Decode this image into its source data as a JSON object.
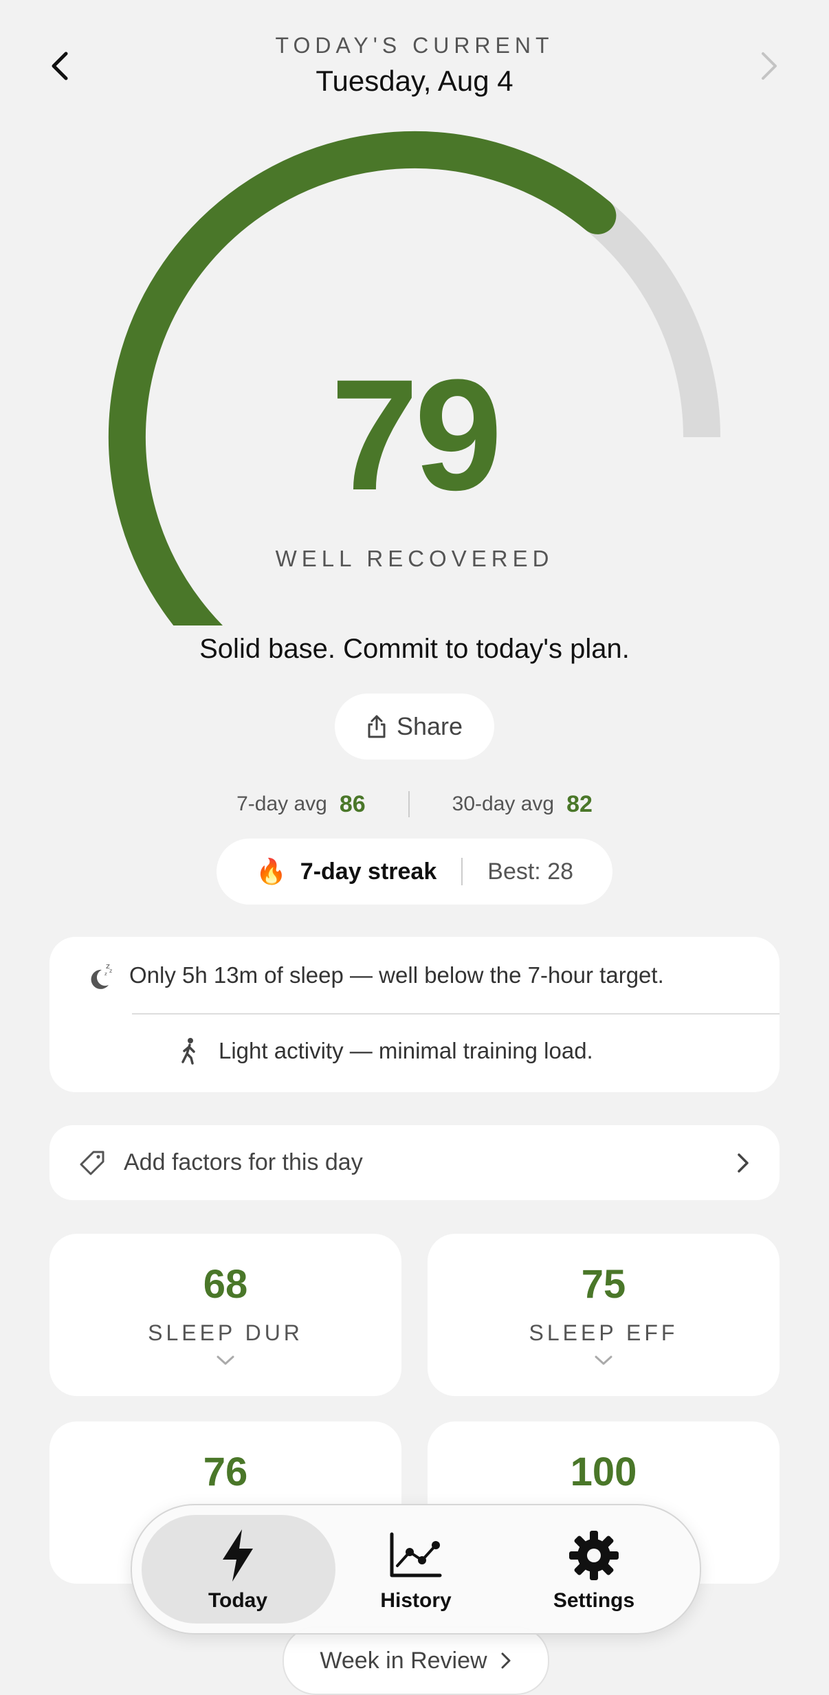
{
  "header": {
    "eyebrow": "TODAY'S CURRENT",
    "date": "Tuesday, Aug 4",
    "back_icon": "chevron-left-icon",
    "forward_icon": "chevron-right-icon"
  },
  "score": {
    "value": "79",
    "max": 100,
    "status": "WELL RECOVERED",
    "tagline": "Solid base. Commit to today's plan.",
    "accent_color": "#4a7729",
    "track_color": "#dadada"
  },
  "share": {
    "label": "Share",
    "icon": "share-icon"
  },
  "averages": {
    "seven_day_label": "7-day avg",
    "seven_day_value": "86",
    "thirty_day_label": "30-day avg",
    "thirty_day_value": "82"
  },
  "streak": {
    "emoji": "🔥",
    "label": "7-day streak",
    "best": "Best: 28"
  },
  "insights": [
    {
      "icon": "sleep-moon-icon",
      "text": "Only 5h 13m of sleep — well below the 7-hour target."
    },
    {
      "icon": "walking-icon",
      "text": "Light activity — minimal training load."
    }
  ],
  "factors": {
    "label": "Add factors for this day",
    "icon": "tag-icon"
  },
  "metrics": [
    {
      "value": "68",
      "label": "SLEEP DUR"
    },
    {
      "value": "75",
      "label": "SLEEP EFF"
    },
    {
      "value": "76",
      "label": ""
    },
    {
      "value": "100",
      "label": ""
    }
  ],
  "tabs": [
    {
      "label": "Today",
      "icon": "bolt-icon",
      "selected": true
    },
    {
      "label": "History",
      "icon": "chart-line-icon",
      "selected": false
    },
    {
      "label": "Settings",
      "icon": "gear-icon",
      "selected": false
    }
  ],
  "week_review": {
    "label": "Week in Review"
  }
}
